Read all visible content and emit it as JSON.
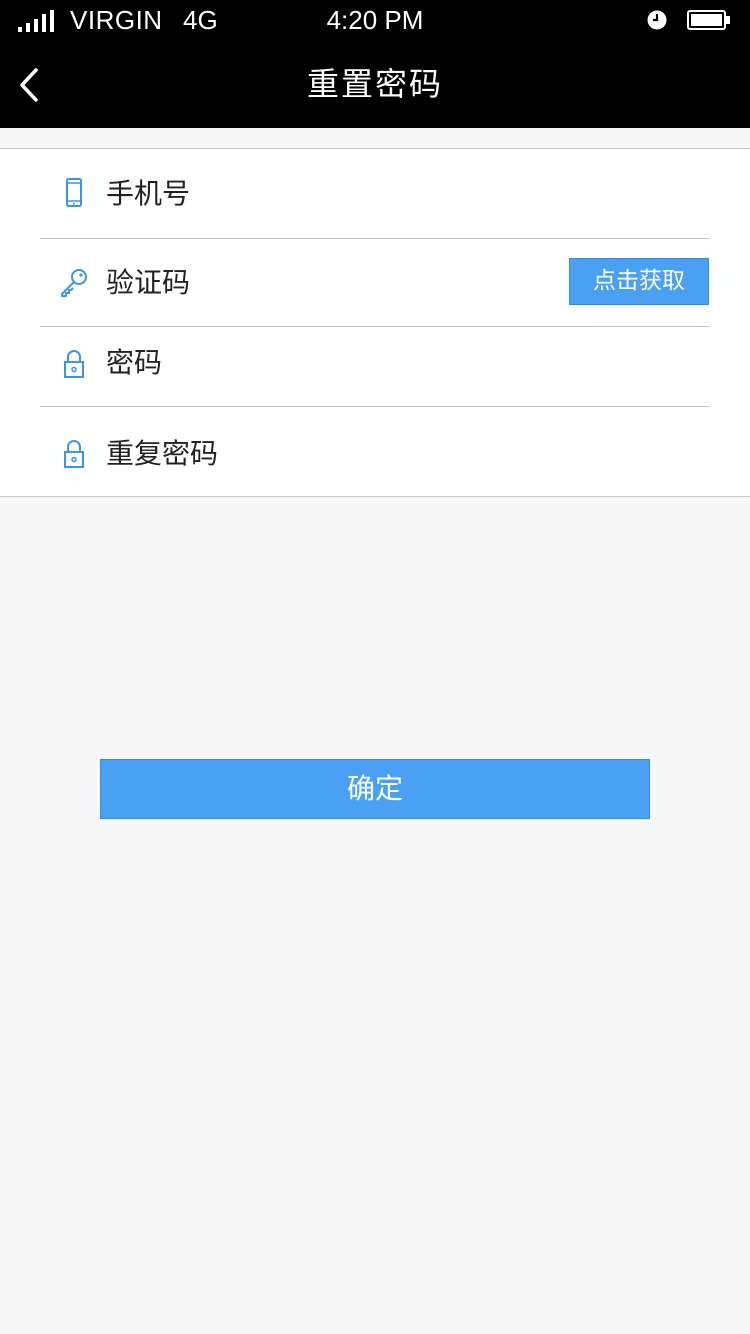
{
  "status_bar": {
    "carrier": "VIRGIN",
    "network": "4G",
    "time": "4:20 PM",
    "icons": [
      "signal-icon",
      "alarm-icon",
      "battery-icon"
    ]
  },
  "nav": {
    "title": "重置密码",
    "back_icon": "chevron-left-icon"
  },
  "form": {
    "phone": {
      "placeholder": "手机号",
      "icon": "phone-icon"
    },
    "code": {
      "placeholder": "验证码",
      "icon": "key-icon",
      "button_label": "点击获取"
    },
    "password": {
      "placeholder": "密码",
      "icon": "lock-icon"
    },
    "repeat_password": {
      "placeholder": "重复密码",
      "icon": "lock-icon"
    }
  },
  "confirm_label": "确定",
  "colors": {
    "accent": "#4aa0f3",
    "bar": "#000000",
    "background": "#f7f7f7",
    "divider": "#c8c8c8"
  }
}
